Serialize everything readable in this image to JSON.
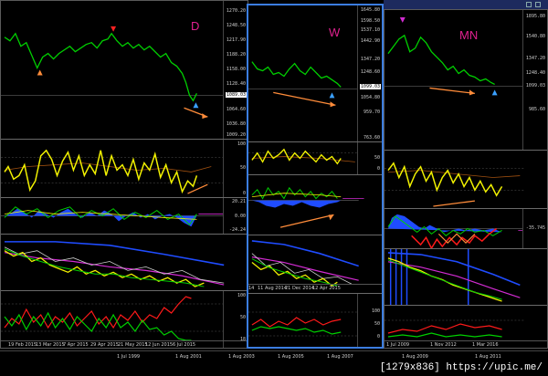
{
  "windows": {
    "daily": {
      "timeframe": "D",
      "price_scale": [
        "1270.20",
        "1248.50",
        "1217.90",
        "1188.20",
        "1158.00",
        "1128.40",
        "1099.03",
        "1064.60",
        "1036.80",
        "1009.20"
      ],
      "price_tag": "1089.03",
      "osc1_scale": [
        "100",
        "50",
        "0"
      ],
      "osc2_scale": [
        "20.21",
        "0.00",
        "-24.24"
      ],
      "osc4_scale": [
        "100",
        "50",
        "18"
      ],
      "dates": [
        "19 Feb 2015",
        "13 Mar 2015",
        "7 Apr 2015",
        "29 Apr 2015",
        "21 May 2015",
        "12 Jun 2015",
        "6 Jul 2015"
      ]
    },
    "weekly": {
      "timeframe": "W",
      "price_scale": [
        "1645.80",
        "1598.50",
        "1537.10",
        "1442.90",
        "1347.20",
        "1248.60",
        "1154.20",
        "1054.80",
        "959.70",
        "763.60"
      ],
      "price_tag": "1099.03",
      "osc1_scale": [
        "50",
        "0"
      ],
      "osc4_scale": [
        "100",
        "50",
        "0"
      ],
      "dates": [
        "14",
        "11 Aug 2014",
        "21 Dec 2014",
        "12 Apr 2015"
      ]
    },
    "monthly": {
      "timeframe": "MN",
      "price_scale": [
        "1895.80",
        "1540.80",
        "1347.20",
        "1248.40",
        "1099.03",
        "985.60"
      ],
      "osc2_scale": [
        "-35.745"
      ],
      "dates": [
        "1 Jul 2009",
        "1 Nov 2012",
        "1 Mar 2016"
      ]
    },
    "back_dates": [
      "1 Jul 1999",
      "1 Aug 2001",
      "1 Aug 2003",
      "1 Aug 2005",
      "1 Aug 2007",
      "1 Aug 2009",
      "1 Aug 2011"
    ]
  },
  "watermark": "[1279x836] https://upic.me/",
  "colors": {
    "price": "#00d000",
    "arrow": "#ff8c3a",
    "osc_main": "#f2f200",
    "hist_blue": "#1f4cff",
    "ma_red": "#ff1a1a",
    "ma_magenta": "#d22bd2",
    "tf_label": "#e0208f"
  }
}
